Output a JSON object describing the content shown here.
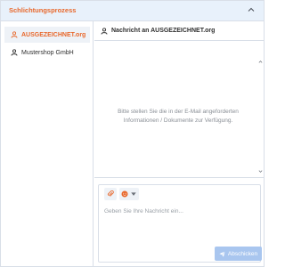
{
  "header": {
    "title": "Schlichtungsprozess",
    "collapse_icon": "chevron-up-icon"
  },
  "sidebar": {
    "items": [
      {
        "label": "AUSGEZEICHNET.org",
        "icon": "user-icon",
        "active": true
      },
      {
        "label": "Mustershop GmbH",
        "icon": "user-icon",
        "active": false
      }
    ]
  },
  "conversation": {
    "title": "Nachricht an AUSGEZEICHNET.org",
    "icon": "user-icon",
    "empty_message": "Bitte stellen Sie die in der E-Mail angeforderten Informationen / Dokumente zur Verfügung."
  },
  "composer": {
    "attach_icon": "paperclip-icon",
    "emoji_icon": "emoji-icon",
    "placeholder": "Geben Sie Ihre Nachricht ein...",
    "value": "",
    "send_label": "Abschicken",
    "send_icon": "paper-plane-icon"
  },
  "colors": {
    "accent": "#e8682c",
    "header_bg": "#e8f1fb",
    "send_button": "#a9c6ef",
    "border": "#d9dfe8"
  }
}
